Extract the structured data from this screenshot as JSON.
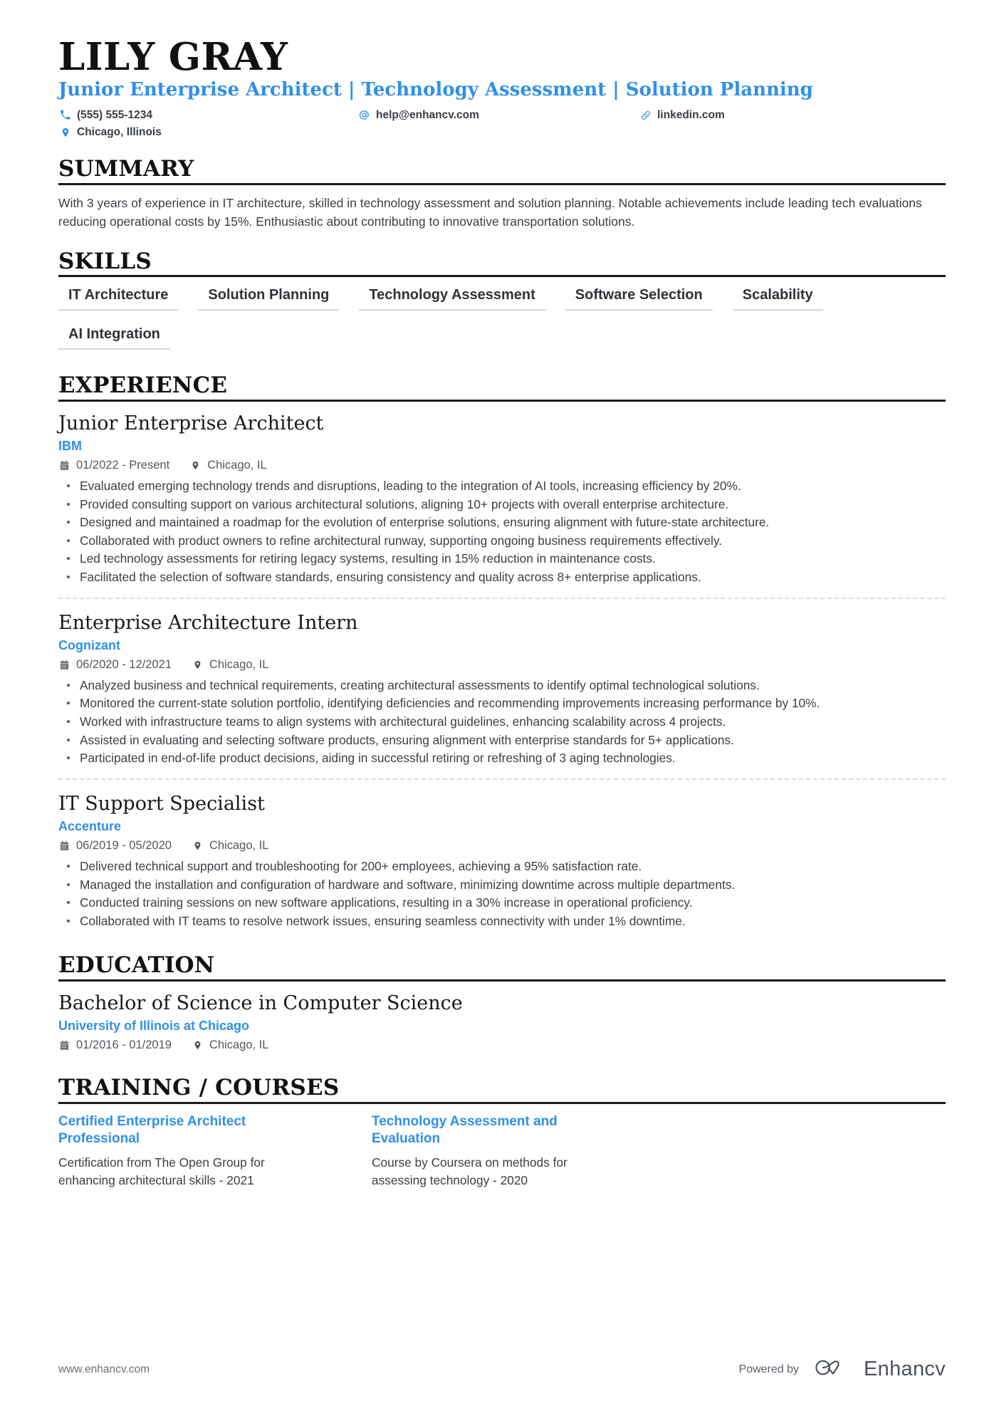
{
  "header": {
    "name": "LILY GRAY",
    "headline": "Junior Enterprise Architect | Technology Assessment | Solution Planning",
    "contacts": {
      "phone": "(555) 555-1234",
      "email": "help@enhancv.com",
      "website": "linkedin.com",
      "location": "Chicago, Illinois"
    },
    "icons": {
      "phone": "phone-icon",
      "email": "at-sign-icon",
      "website": "link-icon",
      "location": "map-pin-icon"
    }
  },
  "accent_color": "#2f8fec",
  "sections": {
    "summary": {
      "title": "SUMMARY",
      "text": "With 3 years of experience in IT architecture, skilled in technology assessment and solution planning. Notable achievements include leading tech evaluations reducing operational costs by 15%. Enthusiastic about contributing to innovative transportation solutions."
    },
    "skills": {
      "title": "SKILLS",
      "items": [
        "IT Architecture",
        "Solution Planning",
        "Technology Assessment",
        "Software Selection",
        "Scalability",
        "AI Integration"
      ]
    },
    "experience": {
      "title": "EXPERIENCE",
      "entries": [
        {
          "title": "Junior Enterprise Architect",
          "organization": "IBM",
          "dates": "01/2022 - Present",
          "location": "Chicago, IL",
          "bullets": [
            "Evaluated emerging technology trends and disruptions, leading to the integration of AI tools, increasing efficiency by 20%.",
            "Provided consulting support on various architectural solutions, aligning 10+ projects with overall enterprise architecture.",
            "Designed and maintained a roadmap for the evolution of enterprise solutions, ensuring alignment with future-state architecture.",
            "Collaborated with product owners to refine architectural runway, supporting ongoing business requirements effectively.",
            "Led technology assessments for retiring legacy systems, resulting in 15% reduction in maintenance costs.",
            "Facilitated the selection of software standards, ensuring consistency and quality across 8+ enterprise applications."
          ]
        },
        {
          "title": "Enterprise Architecture Intern",
          "organization": "Cognizant",
          "dates": "06/2020 - 12/2021",
          "location": "Chicago, IL",
          "bullets": [
            "Analyzed business and technical requirements, creating architectural assessments to identify optimal technological solutions.",
            "Monitored the current-state solution portfolio, identifying deficiencies and recommending improvements increasing performance by 10%.",
            "Worked with infrastructure teams to align systems with architectural guidelines, enhancing scalability across 4 projects.",
            "Assisted in evaluating and selecting software products, ensuring alignment with enterprise standards for 5+ applications.",
            "Participated in end-of-life product decisions, aiding in successful retiring or refreshing of 3 aging technologies."
          ]
        },
        {
          "title": "IT Support Specialist",
          "organization": "Accenture",
          "dates": "06/2019 - 05/2020",
          "location": "Chicago, IL",
          "bullets": [
            "Delivered technical support and troubleshooting for 200+ employees, achieving a 95% satisfaction rate.",
            "Managed the installation and configuration of hardware and software, minimizing downtime across multiple departments.",
            "Conducted training sessions on new software applications, resulting in a 30% increase in operational proficiency.",
            "Collaborated with IT teams to resolve network issues, ensuring seamless connectivity with under 1% downtime."
          ]
        }
      ]
    },
    "education": {
      "title": "EDUCATION",
      "entries": [
        {
          "title": "Bachelor of Science in Computer Science",
          "organization": "University of Illinois at Chicago",
          "dates": "01/2016 - 01/2019",
          "location": "Chicago, IL"
        }
      ]
    },
    "courses": {
      "title": "TRAINING / COURSES",
      "items": [
        {
          "title": "Certified Enterprise Architect Professional",
          "description": "Certification from The Open Group for enhancing architectural skills - 2021"
        },
        {
          "title": "Technology Assessment and Evaluation",
          "description": "Course by Coursera on methods for assessing technology - 2020"
        }
      ]
    }
  },
  "footer": {
    "url": "www.enhancv.com",
    "powered_by": "Powered by",
    "brand": "Enhancv"
  }
}
